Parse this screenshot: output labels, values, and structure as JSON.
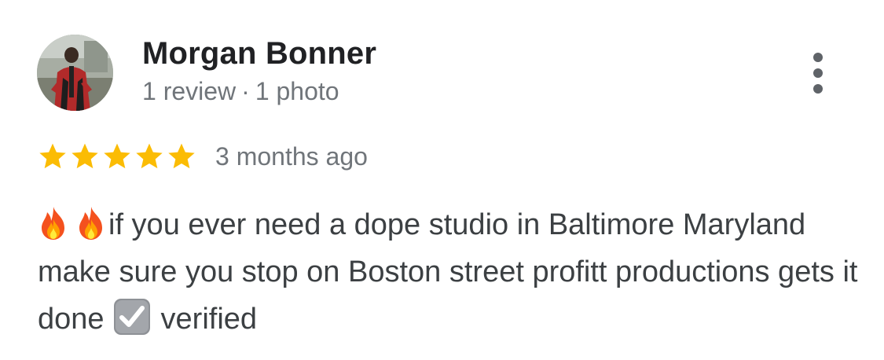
{
  "review": {
    "author": {
      "name": "Morgan Bonner",
      "review_count": "1 review",
      "separator": "·",
      "photo_count": "1 photo",
      "avatar": "profile-photo"
    },
    "more_options_icon": "vertical-ellipsis-icon",
    "rating": 5,
    "rating_max": 5,
    "star_color": "#fbbc04",
    "date": "3 months ago",
    "text": {
      "leading_emoji": [
        "fire-emoji",
        "fire-emoji"
      ],
      "line_part_1": "if you ever need a dope studio in Baltimore Maryland make sure you stop on Boston street profitt productions gets it done",
      "inline_emoji": "check-box-emoji",
      "line_part_2": "verified"
    }
  },
  "colors": {
    "name_text": "#202124",
    "meta_text": "#70757a",
    "body_text": "#3c4043",
    "star": "#fbbc04"
  }
}
